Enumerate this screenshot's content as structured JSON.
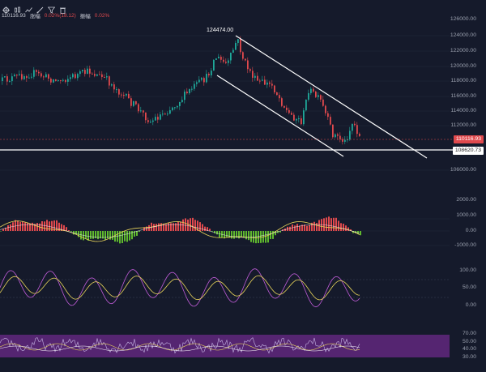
{
  "toolbar": {
    "icons": [
      "crosshair-icon",
      "candle-icon",
      "indicator-icon",
      "draw-icon",
      "filter-icon",
      "trash-icon"
    ]
  },
  "price_info": {
    "price": "110116.93",
    "change_label": "涨幅",
    "change_value": "0.02%(18.12)",
    "amp_label": "振幅",
    "amp_value": "0.02%"
  },
  "axis": {
    "main": [
      "126000.00",
      "124000.00",
      "122000.00",
      "120000.00",
      "118000.00",
      "116000.00",
      "114000.00",
      "112000.00",
      "106000.00"
    ],
    "macd": [
      "2000.00",
      "1000.00",
      "0.00",
      "-1000.00"
    ],
    "rsi": [
      "100.00",
      "50.00",
      "0.00"
    ],
    "kdj": [
      "70.00",
      "50.00",
      "40.00",
      "30.00"
    ]
  },
  "current_price_tag": "110116.93",
  "support_tag": "108620.73",
  "peak_label": "124474.00",
  "colors": {
    "background": "#151a2b",
    "up": "#1fa99a",
    "down": "#e0494d",
    "macd_pos": "#e0494d",
    "macd_neg": "#5fb82e",
    "yellow": "#e8d45a",
    "purple": "#c05cd8",
    "band": "#6b2a8a",
    "line": "#ffffff"
  }
}
